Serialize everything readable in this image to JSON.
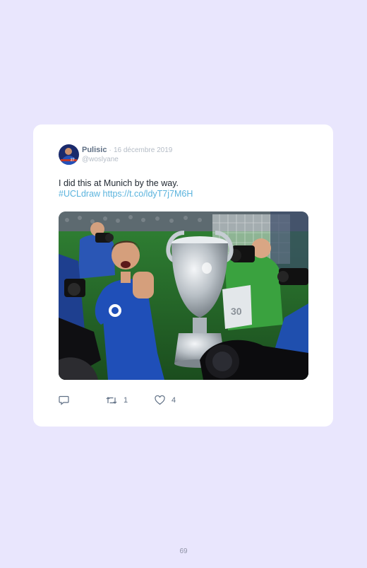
{
  "tweet": {
    "author_name": "Pulisic",
    "separator": "·",
    "date": "16 décembre 2019",
    "handle": "@woslyane",
    "text": "I did this at Munich by the way.",
    "hashtag": "#UCLdraw",
    "link": "https://t.co/ldyT7j7M6H"
  },
  "actions": {
    "retweet_count": "1",
    "like_count": "4"
  },
  "avatar": {
    "jersey_number": "27"
  },
  "photo": {
    "banner_number": "30"
  },
  "colors": {
    "page_background": "#e9e6fd",
    "card_background": "#ffffff",
    "link": "#5ab3dd",
    "muted_text": "#b4bcc6",
    "author_text": "#5f6f84"
  },
  "footer": {
    "page_number": "69"
  }
}
